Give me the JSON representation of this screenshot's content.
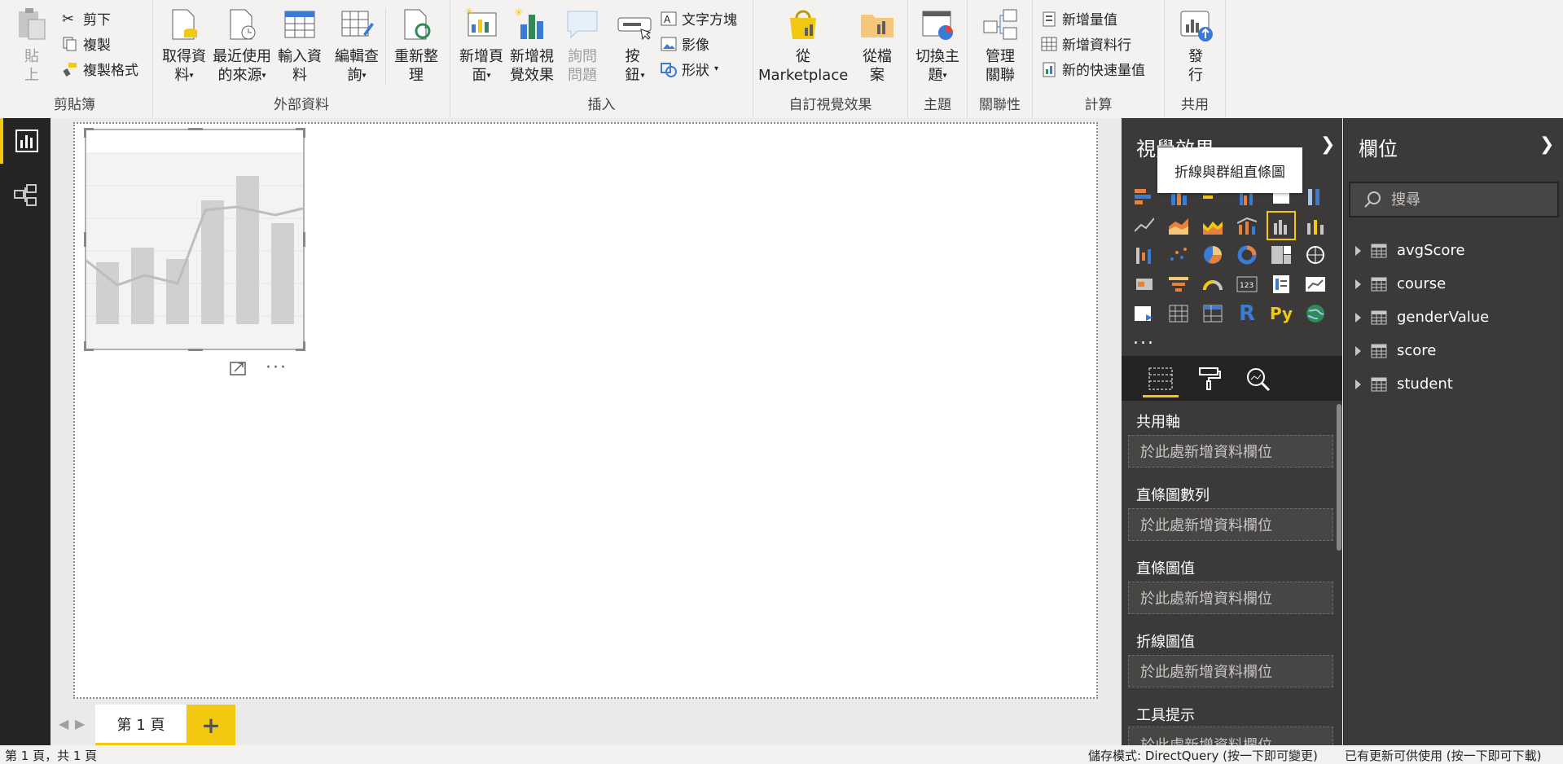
{
  "ribbon": {
    "groups": {
      "clipboard": "剪貼簿",
      "external_data": "外部資料",
      "insert": "插入",
      "custom_visuals": "自訂視覺效果",
      "themes": "主題",
      "relationships": "關聯性",
      "calculations": "計算",
      "share": "共用"
    },
    "clipboard": {
      "paste": "貼上",
      "cut": "剪下",
      "copy": "複製",
      "format_painter": "複製格式"
    },
    "external": {
      "get_data": "取得資料",
      "recent_sources": "最近使用的來源",
      "enter_data": "輸入資料",
      "edit_queries": "編輯查詢",
      "refresh": "重新整理"
    },
    "insert": {
      "new_page": "新增頁面",
      "new_visual": "新增視覺效果",
      "ask_question": "詢問問題",
      "buttons": "按鈕",
      "text_box": "文字方塊",
      "image": "影像",
      "shapes": "形狀"
    },
    "custom": {
      "marketplace_line1": "從",
      "marketplace_line2": "Marketplace",
      "from_file": "從檔案"
    },
    "themes": {
      "switch_theme": "切換主題"
    },
    "relationships": {
      "manage": "管理關聯"
    },
    "calc": {
      "new_measure": "新增量值",
      "new_column": "新增資料行",
      "new_quick_measure": "新的快速量值"
    },
    "share": {
      "publish": "發行"
    }
  },
  "pages": {
    "current_tab": "第 1 頁",
    "add_icon": "+"
  },
  "visualizations": {
    "title": "視覺效果",
    "tooltip": "折線與群組直條圖",
    "more": "...",
    "wells": [
      {
        "title": "共用軸",
        "placeholder": "於此處新增資料欄位"
      },
      {
        "title": "直條圖數列",
        "placeholder": "於此處新增資料欄位"
      },
      {
        "title": "直條圖值",
        "placeholder": "於此處新增資料欄位"
      },
      {
        "title": "折線圖值",
        "placeholder": "於此處新增資料欄位"
      },
      {
        "title": "工具提示",
        "placeholder": "於此處新增資料欄位"
      }
    ]
  },
  "fields": {
    "title": "欄位",
    "search_placeholder": "搜尋",
    "tables": [
      "avgScore",
      "course",
      "genderValue",
      "score",
      "student"
    ]
  },
  "status": {
    "left": "第 1 頁，共 1 頁",
    "storage_mode": "儲存模式: DirectQuery (按一下即可變更)",
    "update": "已有更新可供使用 (按一下即可下載)"
  },
  "colors": {
    "accent": "#f2c811",
    "pane_bg": "#3b3a39",
    "nav_bg": "#252423"
  }
}
